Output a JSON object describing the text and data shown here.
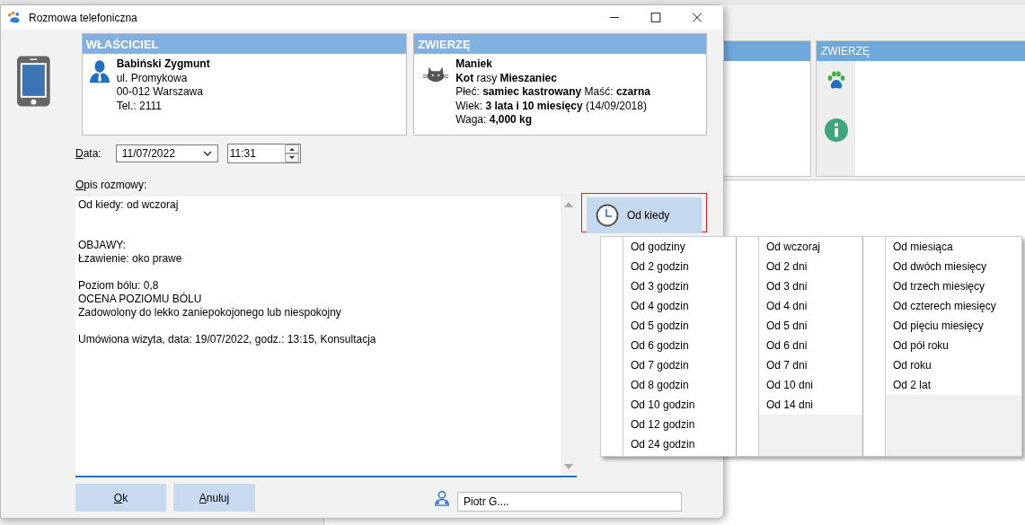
{
  "background": {
    "panel_title": "ZWIERZĘ"
  },
  "window": {
    "title": "Rozmowa telefoniczna"
  },
  "owner": {
    "header": "WŁAŚCICIEL",
    "lines": [
      "Babiński Zygmunt",
      "ul. Promykowa",
      "00-012  Warszawa",
      "Tel.: 2111"
    ]
  },
  "pet": {
    "header": "ZWIERZĘ",
    "lines": [
      "Maniek",
      "**Kot** rasy **Mieszaniec**",
      "Płeć: **samiec kastrowany**  Maść: **czarna**",
      "Wiek: **3 lata i 10 miesięcy** (14/09/2018)",
      "Waga: **4,000 kg**"
    ]
  },
  "date": {
    "label": "Data:",
    "value": "11/07/2022",
    "time": "11:31"
  },
  "description": {
    "label": "Opis rozmowy:",
    "value": "Od kiedy: od wczoraj\n\n\nOBJAWY:\nŁzawienie: oko prawe\n\nPoziom bólu: 0,8\nOCENA POZIOMU BÓLU\nZadowolony do lekko zaniepokojonego lub niespokojny\n\nUmówiona wizyta, data: 19/07/2022, godz.: 13:15, Konsultacja"
  },
  "since_button": {
    "label": "Od kiedy",
    "highlighted": true
  },
  "menu": {
    "columns": [
      {
        "items": [
          "Od godziny",
          "Od 2 godzin",
          "Od 3 godzin",
          "Od 4 godzin",
          "Od 5 godzin",
          "Od 6 godzin",
          "Od 7 godzin",
          "Od 8 godzin",
          "Od 10 godzin",
          "Od 12 godzin",
          "Od 24 godzin"
        ]
      },
      {
        "items": [
          "Od wczoraj",
          "Od 2 dni",
          "Od 3 dni",
          "Od 4 dni",
          "Od 5 dni",
          "Od 6 dni",
          "Od 7 dni",
          "Od 10 dni",
          "Od 14 dni"
        ]
      },
      {
        "items": [
          "Od miesiąca",
          "Od dwóch miesięcy",
          "Od trzech miesięcy",
          "Od czterech miesięcy",
          "Od pięciu miesięcy",
          "Od pół roku",
          "Od roku",
          "Od 2 lat"
        ]
      }
    ]
  },
  "buttons": [
    "Ok",
    "Anuluj"
  ],
  "user": {
    "value": "Piotr G...."
  }
}
